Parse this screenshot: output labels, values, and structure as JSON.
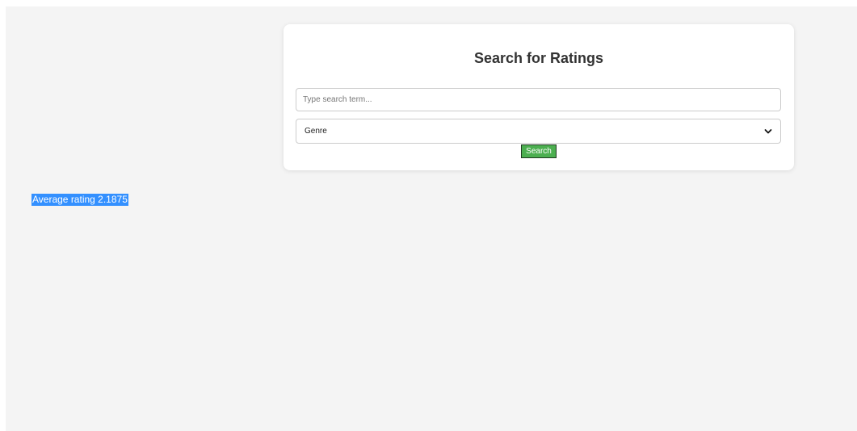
{
  "search_card": {
    "title": "Search for Ratings",
    "search_input": {
      "value": "",
      "placeholder": "Type search term..."
    },
    "genre_select": {
      "selected": "Genre",
      "icon": "chevron-down-icon"
    },
    "search_button_label": "Search"
  },
  "result": {
    "average_rating_text": "Average rating 2.1875"
  },
  "colors": {
    "page_background": "#f4f4f4",
    "card_background": "#ffffff",
    "button_green": "#4caf50",
    "selection_blue": "#3390ff"
  }
}
